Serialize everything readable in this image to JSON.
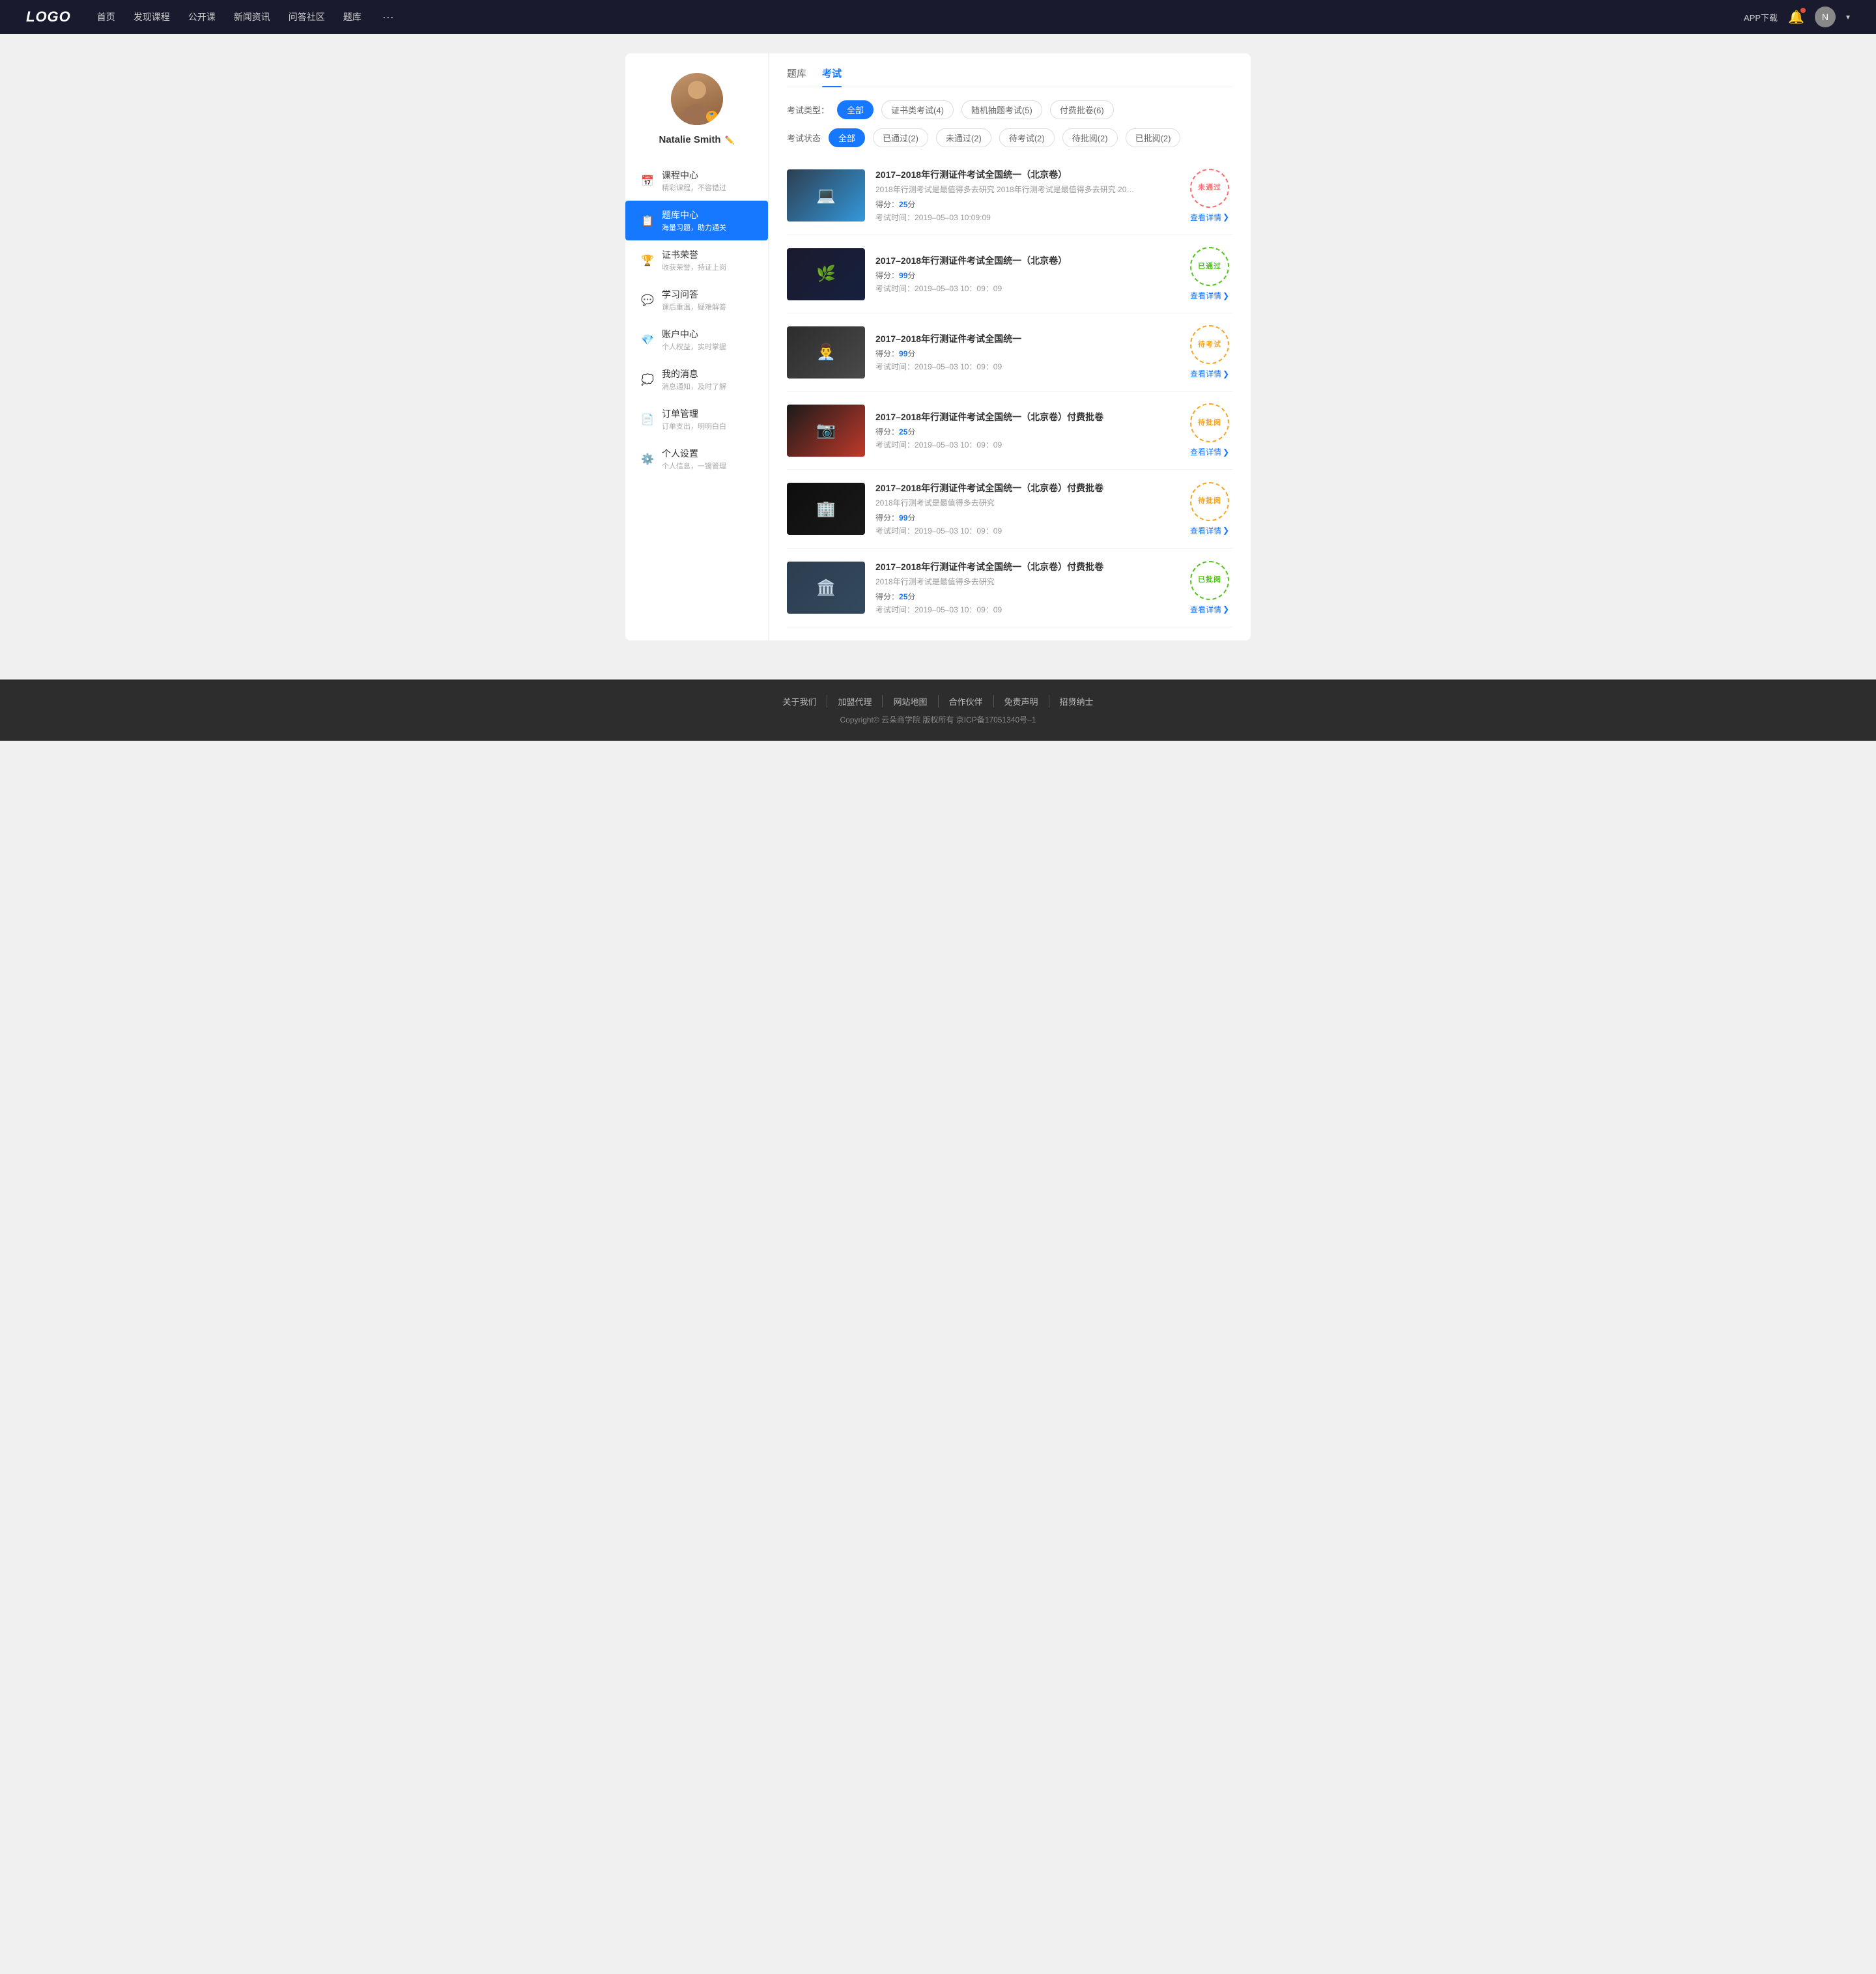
{
  "nav": {
    "logo": "LOGO",
    "links": [
      {
        "label": "首页",
        "id": "home"
      },
      {
        "label": "发现课程",
        "id": "discover"
      },
      {
        "label": "公开课",
        "id": "open"
      },
      {
        "label": "新闻资讯",
        "id": "news"
      },
      {
        "label": "问答社区",
        "id": "qa"
      },
      {
        "label": "题库",
        "id": "bank"
      },
      {
        "label": "···",
        "id": "more"
      }
    ],
    "app_btn": "APP下载",
    "user_name": "Natalie Smith"
  },
  "sidebar": {
    "username": "Natalie Smith",
    "menu": [
      {
        "id": "course",
        "icon": "📅",
        "title": "课程中心",
        "subtitle": "精彩课程，不容错过",
        "active": false
      },
      {
        "id": "bank",
        "icon": "📋",
        "title": "题库中心",
        "subtitle": "海量习题，助力通关",
        "active": true
      },
      {
        "id": "honor",
        "icon": "🏆",
        "title": "证书荣誉",
        "subtitle": "收获荣誉，持证上岗",
        "active": false
      },
      {
        "id": "qa",
        "icon": "💬",
        "title": "学习问答",
        "subtitle": "课后重温，疑难解答",
        "active": false
      },
      {
        "id": "account",
        "icon": "💎",
        "title": "账户中心",
        "subtitle": "个人权益，实时掌握",
        "active": false
      },
      {
        "id": "msg",
        "icon": "💭",
        "title": "我的消息",
        "subtitle": "消息通知，及时了解",
        "active": false
      },
      {
        "id": "order",
        "icon": "📄",
        "title": "订单管理",
        "subtitle": "订单支出，明明白白",
        "active": false
      },
      {
        "id": "settings",
        "icon": "⚙️",
        "title": "个人设置",
        "subtitle": "个人信息，一键管理",
        "active": false
      }
    ]
  },
  "main": {
    "tabs": [
      {
        "label": "题库",
        "active": false
      },
      {
        "label": "考试",
        "active": true
      }
    ],
    "filter_type": {
      "label": "考试类型：",
      "options": [
        {
          "label": "全部",
          "active": true
        },
        {
          "label": "证书类考试(4)",
          "active": false
        },
        {
          "label": "随机抽题考试(5)",
          "active": false
        },
        {
          "label": "付费批卷(6)",
          "active": false
        }
      ]
    },
    "filter_status": {
      "label": "考试状态",
      "options": [
        {
          "label": "全部",
          "active": true
        },
        {
          "label": "已通过(2)",
          "active": false
        },
        {
          "label": "未通过(2)",
          "active": false
        },
        {
          "label": "待考试(2)",
          "active": false
        },
        {
          "label": "待批阅(2)",
          "active": false
        },
        {
          "label": "已批阅(2)",
          "active": false
        }
      ]
    },
    "exams": [
      {
        "id": 1,
        "title": "2017–2018年行测证件考试全国统一（北京卷）",
        "desc": "2018年行测考试是最值得多去研究 2018年行测考试是最值得多去研究 2018年行...",
        "score": "25",
        "time": "2019–05–03  10:09:09",
        "status": "notpassed",
        "status_text": "未通过",
        "detail_link": "查看详情",
        "thumb_class": "thumb-1"
      },
      {
        "id": 2,
        "title": "2017–2018年行测证件考试全国统一（北京卷）",
        "desc": "",
        "score": "99",
        "time": "2019–05–03  10：09：09",
        "status": "passed",
        "status_text": "已通过",
        "detail_link": "查看详情",
        "thumb_class": "thumb-2"
      },
      {
        "id": 3,
        "title": "2017–2018年行测证件考试全国统一",
        "desc": "",
        "score": "99",
        "time": "2019–05–03  10：09：09",
        "status": "pending",
        "status_text": "待考试",
        "detail_link": "查看详情",
        "thumb_class": "thumb-3"
      },
      {
        "id": 4,
        "title": "2017–2018年行测证件考试全国统一（北京卷）付费批卷",
        "desc": "",
        "score": "25",
        "time": "2019–05–03  10：09：09",
        "status": "review",
        "status_text": "待批阅",
        "detail_link": "查看详情",
        "thumb_class": "thumb-4"
      },
      {
        "id": 5,
        "title": "2017–2018年行测证件考试全国统一（北京卷）付费批卷",
        "desc": "2018年行测考试是最值得多去研究",
        "score": "99",
        "time": "2019–05–03  10：09：09",
        "status": "review",
        "status_text": "待批阅",
        "detail_link": "查看详情",
        "thumb_class": "thumb-5"
      },
      {
        "id": 6,
        "title": "2017–2018年行测证件考试全国统一（北京卷）付费批卷",
        "desc": "2018年行测考试是最值得多去研究",
        "score": "25",
        "time": "2019–05–03  10：09：09",
        "status": "reviewed",
        "status_text": "已批阅",
        "detail_link": "查看详情",
        "thumb_class": "thumb-6"
      }
    ]
  },
  "footer": {
    "links": [
      {
        "label": "关于我们"
      },
      {
        "label": "加盟代理"
      },
      {
        "label": "网站地图"
      },
      {
        "label": "合作伙伴"
      },
      {
        "label": "免责声明"
      },
      {
        "label": "招贤纳士"
      }
    ],
    "copyright": "Copyright© 云朵商学院  版权所有    京ICP备17051340号–1"
  }
}
